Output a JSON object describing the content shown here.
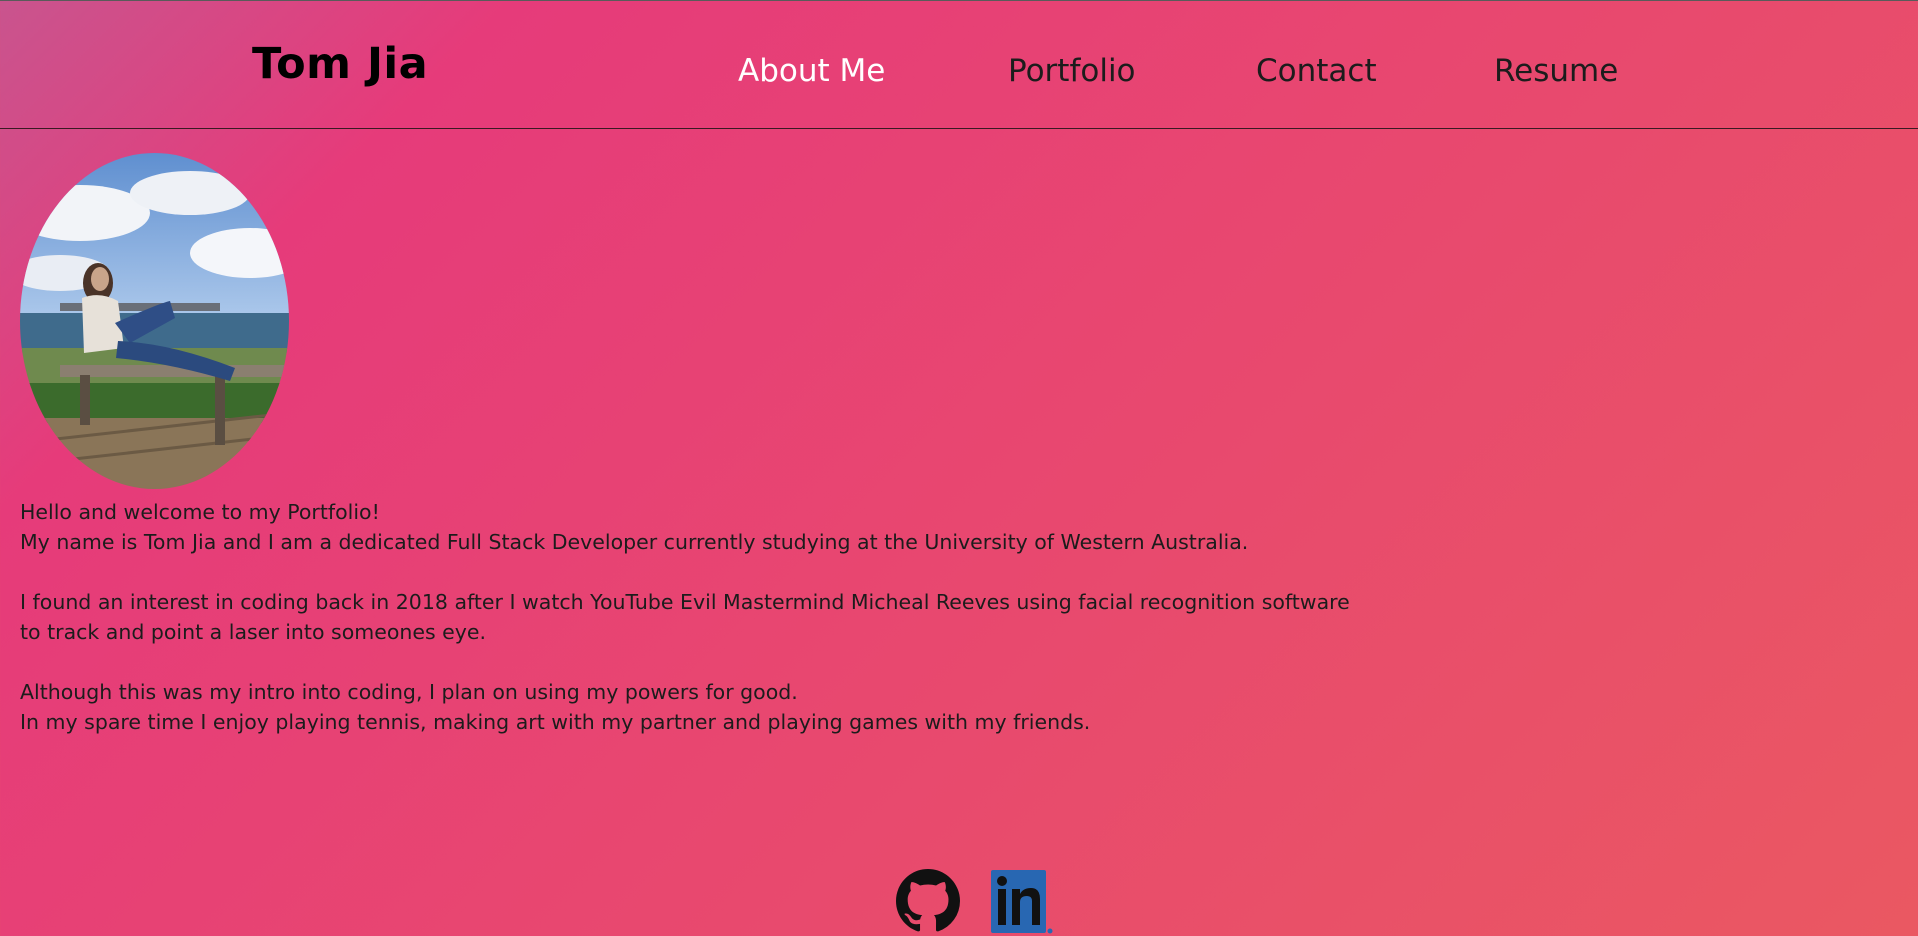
{
  "header": {
    "brand": "Tom Jia",
    "nav": [
      {
        "label": "About Me",
        "active": true
      },
      {
        "label": "Portfolio",
        "active": false
      },
      {
        "label": "Contact",
        "active": false
      },
      {
        "label": "Resume",
        "active": false
      }
    ]
  },
  "bio": {
    "lines": [
      "Hello and welcome to my Portfolio!",
      "My name is Tom Jia and I am a dedicated Full Stack Developer currently studying at the University of Western Australia.",
      "I found an interest in coding back in 2018 after I watch YouTube Evil Mastermind Micheal Reeves using facial recognition software to track and point a laser into someones eye.",
      "Although this was my intro into coding, I plan on using my powers for good.",
      "In my spare time I enjoy playing tennis, making art with my partner and playing games with my friends."
    ]
  },
  "social": {
    "github_icon": "github-icon",
    "linkedin_icon": "linkedin-icon",
    "linkedin_text": "in"
  },
  "colors": {
    "gradient_start": "#c9548e",
    "gradient_mid": "#e63b7a",
    "gradient_end": "#ea5862",
    "nav_active": "#ffffff",
    "linkedin_blue": "#2867b2"
  }
}
